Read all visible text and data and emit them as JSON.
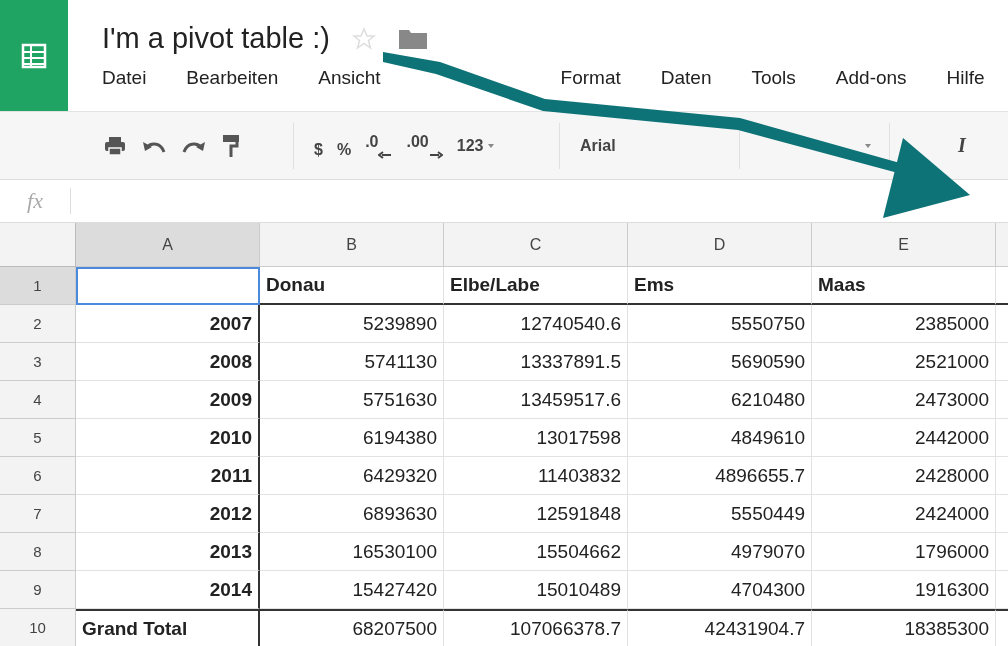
{
  "document": {
    "title": "I'm a pivot table :)",
    "starred": false
  },
  "menu": [
    "Datei",
    "Bearbeiten",
    "Ansicht",
    "Format",
    "Daten",
    "Tools",
    "Add-ons",
    "Hilfe"
  ],
  "toolbar": {
    "currency": "$",
    "percent": "%",
    "decrease_decimals": ".0",
    "increase_decimals": ".00",
    "number_format": "123",
    "font": "Arial",
    "italic": "I"
  },
  "formula_bar": {
    "label": "fx"
  },
  "columns": [
    {
      "label": "A",
      "selected": true
    },
    {
      "label": "B",
      "selected": false
    },
    {
      "label": "C",
      "selected": false
    },
    {
      "label": "D",
      "selected": false
    },
    {
      "label": "E",
      "selected": false
    }
  ],
  "rows": [
    {
      "number": "1",
      "selected": true,
      "kind": "header",
      "values": [
        "Donau",
        "Elbe/Labe",
        "Ems",
        "Maas"
      ]
    },
    {
      "number": "2",
      "selected": false,
      "kind": "year",
      "label": "2007",
      "values": [
        "5239890",
        "12740540.6",
        "5550750",
        "2385000"
      ]
    },
    {
      "number": "3",
      "selected": false,
      "kind": "year",
      "label": "2008",
      "values": [
        "5741130",
        "13337891.5",
        "5690590",
        "2521000"
      ]
    },
    {
      "number": "4",
      "selected": false,
      "kind": "year",
      "label": "2009",
      "values": [
        "5751630",
        "13459517.6",
        "6210480",
        "2473000"
      ]
    },
    {
      "number": "5",
      "selected": false,
      "kind": "year",
      "label": "2010",
      "values": [
        "6194380",
        "13017598",
        "4849610",
        "2442000"
      ]
    },
    {
      "number": "6",
      "selected": false,
      "kind": "year",
      "label": "2011",
      "values": [
        "6429320",
        "11403832",
        "4896655.7",
        "2428000"
      ]
    },
    {
      "number": "7",
      "selected": false,
      "kind": "year",
      "label": "2012",
      "values": [
        "6893630",
        "12591848",
        "5550449",
        "2424000"
      ]
    },
    {
      "number": "8",
      "selected": false,
      "kind": "year",
      "label": "2013",
      "values": [
        "16530100",
        "15504662",
        "4979070",
        "1796000"
      ]
    },
    {
      "number": "9",
      "selected": false,
      "kind": "year",
      "label": "2014",
      "values": [
        "15427420",
        "15010489",
        "4704300",
        "1916300"
      ]
    },
    {
      "number": "10",
      "selected": false,
      "kind": "total",
      "label": "Grand Total",
      "values": [
        "68207500",
        "107066378.7",
        "42431904.7",
        "18385300"
      ]
    }
  ]
}
